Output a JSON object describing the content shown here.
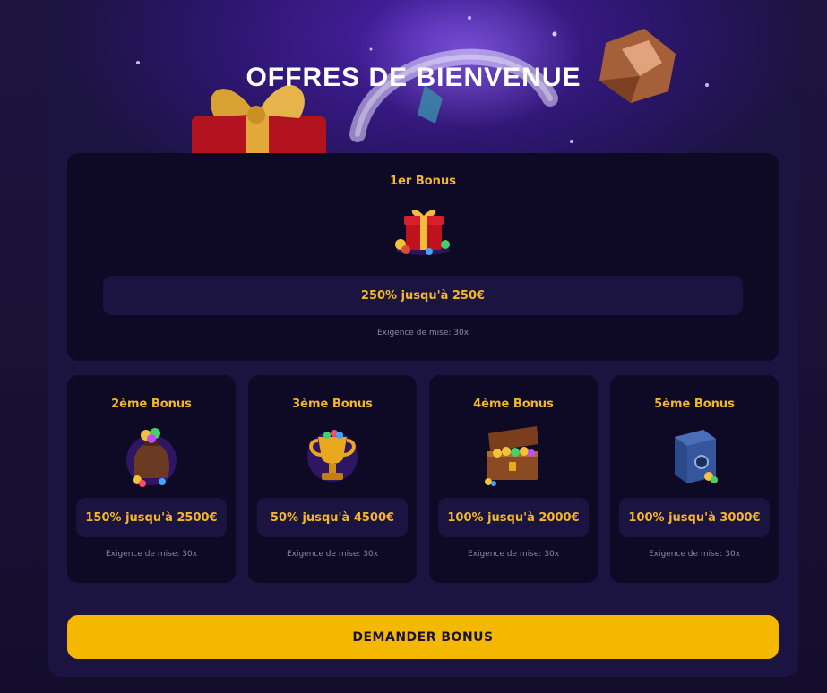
{
  "header": {
    "title": "OFFRES DE BIENVENUE"
  },
  "bonuses": [
    {
      "title": "1er Bonus",
      "offer": "250% jusqu'à 250€",
      "wager": "Exigence de mise: 30x",
      "icon": "gift-box-icon"
    },
    {
      "title": "2ème Bonus",
      "offer": "150% jusqu'à 2500€",
      "wager": "Exigence de mise: 30x",
      "icon": "money-bag-icon"
    },
    {
      "title": "3ème Bonus",
      "offer": "50% jusqu'à 4500€",
      "wager": "Exigence de mise: 30x",
      "icon": "trophy-icon"
    },
    {
      "title": "4ème Bonus",
      "offer": "100% jusqu'à 2000€",
      "wager": "Exigence de mise: 30x",
      "icon": "treasure-chest-icon"
    },
    {
      "title": "5ème Bonus",
      "offer": "100% jusqu'à 3000€",
      "wager": "Exigence de mise: 30x",
      "icon": "safe-icon"
    }
  ],
  "cta": {
    "label": "DEMANDER BONUS"
  },
  "colors": {
    "accent": "#f5b724",
    "button": "#f5b800",
    "card": "#0e0a26",
    "panel": "#1b1340"
  }
}
